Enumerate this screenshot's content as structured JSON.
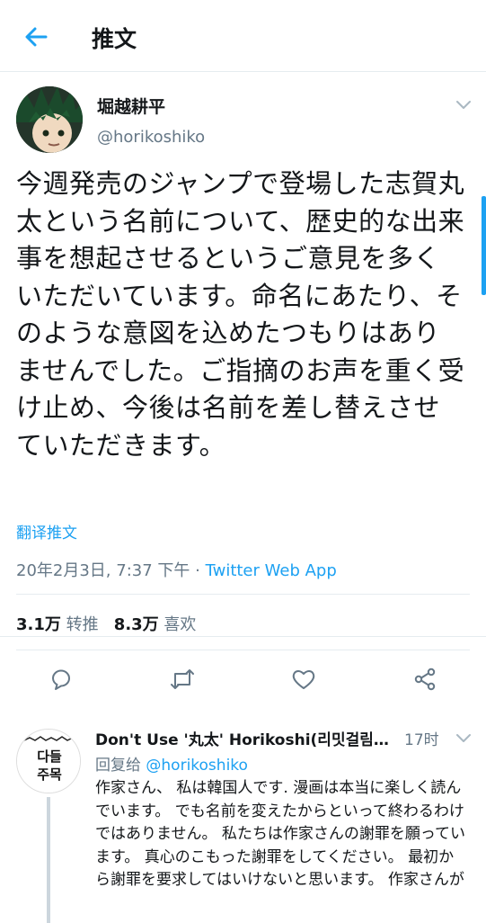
{
  "header": {
    "title": "推文",
    "back_icon": "arrow-left-icon"
  },
  "tweet": {
    "author_name": "堀越耕平",
    "author_handle": "@horikoshiko",
    "text": "今週発売のジャンプで登場した志賀丸太という名前について、歴史的な出来事を想起させるというご意見を多くいただいています。命名にあたり、そのような意図を込めたつもりはありませんでした。ご指摘のお声を重く受け止め、今後は名前を差し替えさせていただきます。",
    "translate_label": "翻译推文",
    "timestamp": "20年2月3日, 7:37 下午",
    "separator": " · ",
    "source": "Twitter Web App",
    "retweet_count": "3.1万",
    "retweet_label": "转推",
    "like_count": "8.3万",
    "like_label": "喜欢"
  },
  "reply": {
    "author_name": "Don't Use '丸太' Horikoshi(리밋걸림 …",
    "time": "17时",
    "reply_prefix": "回复给",
    "reply_handle": "@horikoshiko",
    "avatar_text": "다들 주목",
    "text": "作家さん、 私は韓国人です. 漫画は本当に楽しく読んでいます。 でも名前を変えたからといって終わるわけではありません。 私たちは作家さんの謝罪を願っています。 真心のこもった謝罪をしてください。 最初から謝罪を要求してはいけないと思います。 作家さんが"
  },
  "colors": {
    "accent": "#1da1f2",
    "secondary_text": "#657786",
    "divider": "#e6ecf0"
  }
}
